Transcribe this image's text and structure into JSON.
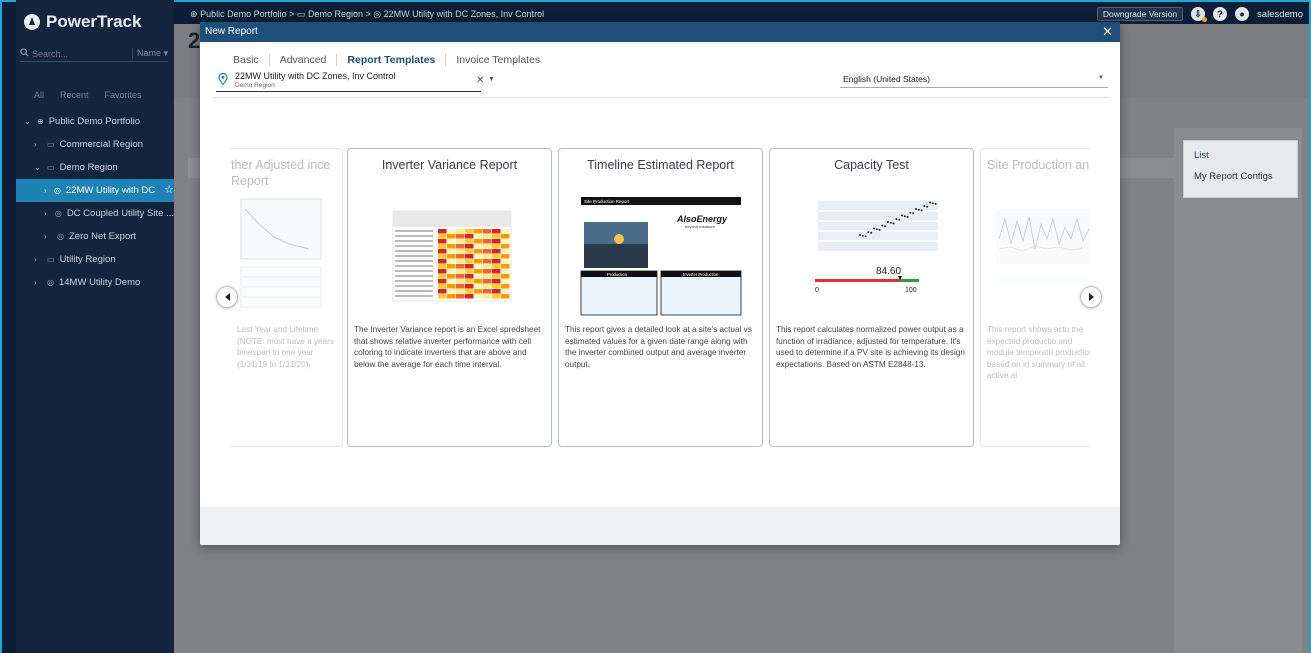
{
  "app": {
    "brand": "PowerTrack"
  },
  "sidebar": {
    "search_placeholder": "Search...",
    "search_mode": "Name",
    "filter_tabs": [
      "All",
      "Recent",
      "Favorites"
    ],
    "tree": [
      {
        "label": "Public Demo Portfolio"
      },
      {
        "label": "Commercial Region"
      },
      {
        "label": "Demo Region"
      },
      {
        "label": "22MW Utility with DC"
      },
      {
        "label": "DC Coupled Utility Site ..."
      },
      {
        "label": "Zero Net Export"
      },
      {
        "label": "Utility Region"
      },
      {
        "label": "14MW Utility Demo"
      }
    ]
  },
  "topbar": {
    "breadcrumb_1": "Public Demo Portfolio",
    "breadcrumb_2": "Demo Region",
    "breadcrumb_3": "22MW Utility with DC Zones, Inv Control",
    "sep": ">",
    "downgrade": "Downgrade Version",
    "user": "salesdemo"
  },
  "background": {
    "page_title": "2",
    "right_panel_title": "List",
    "right_panel_item": "My Report Configs"
  },
  "modal": {
    "title": "New Report",
    "close": "✕",
    "tabs": [
      "Basic",
      "Advanced",
      "Report Templates",
      "Invoice Templates"
    ],
    "active_tab": "Report Templates",
    "site_name": "22MW Utility with DC Zones, Inv Control",
    "site_region": "Demo Region",
    "language": "English (United States)",
    "cards": [
      {
        "title": "ther Adjusted ince Report",
        "desc": "Last Year and Lifetime (NOTE: must have a years timespan to one year (1/31/19 to 1/31/20)."
      },
      {
        "title": "Inverter Variance Report",
        "desc": "The Inverter Variance report is an Excel spredsheet that shows relative inverter performance with cell coloring to indicate inverters that are above and below the average for each time interval."
      },
      {
        "title": "Timeline Estimated Report",
        "desc": "This report gives a detailed look at a site's actual vs estimated values for a given date range along with the inverter combined output and average inverter output."
      },
      {
        "title": "Capacity Test",
        "desc": "This report calculates normalized power output as a function of irradiance, adjusted for temperature. It's used to determine if a PV site is achieving its design expectations. Based on ASTM E2848-13.",
        "gauge_value": "84.60",
        "gauge_min": "0",
        "gauge_max": "100"
      },
      {
        "title": "Site Production an Rep",
        "desc": "This report shows actu the expected productio and module temperatu production based on iri summary of all active al"
      }
    ],
    "thumb_also": "AlsoEnergy",
    "thumb_also_sub": "beyond measure",
    "thumb_site_prod": "Site Production Report",
    "thumb_production": "Production",
    "thumb_inv_production": "Inverter Production"
  },
  "colors": {
    "modal_header": "#1e4f7a",
    "sidebar_bg": "#13253d",
    "active_tree": "#1e83b4",
    "accent": "#1ca6d6"
  }
}
